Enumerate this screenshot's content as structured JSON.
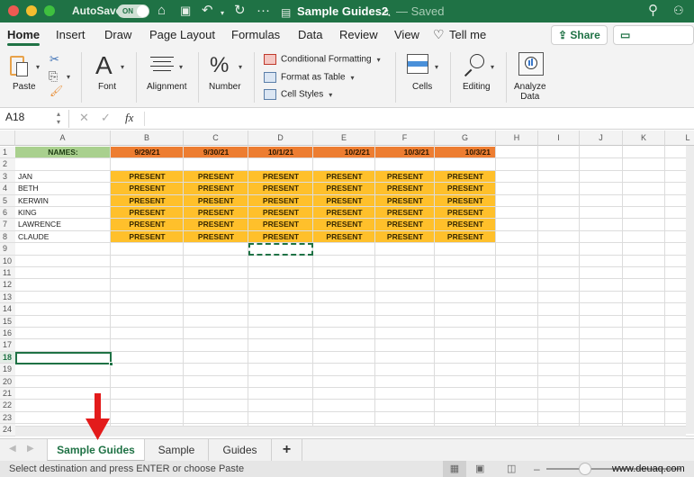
{
  "titlebar": {
    "autosave_label": "AutoSave",
    "autosave_state": "ON",
    "document_title": "Sample Guides2",
    "document_status": "— Saved",
    "icons": [
      "home-icon",
      "save-icon",
      "undo-icon",
      "redo-icon",
      "more-icon",
      "search-icon",
      "share-people-icon"
    ]
  },
  "tabs": [
    {
      "label": "Home",
      "active": true
    },
    {
      "label": "Insert"
    },
    {
      "label": "Draw"
    },
    {
      "label": "Page Layout"
    },
    {
      "label": "Formulas"
    },
    {
      "label": "Data"
    },
    {
      "label": "Review"
    },
    {
      "label": "View"
    }
  ],
  "tell_me": "Tell me",
  "share_label": "Share",
  "comments_label": "Comments",
  "ribbon": {
    "paste": "Paste",
    "font": "Font",
    "alignment": "Alignment",
    "number": "Number",
    "conditional_formatting": "Conditional Formatting",
    "format_as_table": "Format as Table",
    "cell_styles": "Cell Styles",
    "cells": "Cells",
    "editing": "Editing",
    "analyze_data_line1": "Analyze",
    "analyze_data_line2": "Data"
  },
  "formula_bar": {
    "name_box": "A18",
    "fx": "fx",
    "formula": ""
  },
  "columns": [
    "A",
    "B",
    "C",
    "D",
    "E",
    "F",
    "G",
    "H",
    "I",
    "J",
    "K",
    "L"
  ],
  "rows": [
    "1",
    "2",
    "3",
    "4",
    "5",
    "6",
    "7",
    "8",
    "9",
    "10",
    "11",
    "12",
    "13",
    "14",
    "15",
    "16",
    "17",
    "18",
    "19",
    "20",
    "21",
    "22",
    "23",
    "24"
  ],
  "sheet": {
    "header_label": "NAMES:",
    "dates": [
      "9/29/21",
      "9/30/21",
      "10/1/21",
      "10/2/21",
      "10/3/21",
      "10/3/21"
    ],
    "names": [
      "JAN",
      "BETH",
      "KERWIN",
      "KING",
      "LAWRENCE",
      "CLAUDE"
    ],
    "status_value": "PRESENT",
    "selected_cell": "A18",
    "copy_marquee_cell": "D9",
    "colors": {
      "names_header_bg": "#a9d08e",
      "date_header_bg": "#ed7d31",
      "present_bg": "#ffc02b",
      "accent": "#1f7245"
    }
  },
  "sheet_tabs": [
    {
      "label": "Sample Guides",
      "active": true
    },
    {
      "label": "Sample"
    },
    {
      "label": "Guides"
    }
  ],
  "add_sheet": "+",
  "status_bar": {
    "message": "Select destination and press ENTER or choose Paste",
    "watermark": "www.deuaq.com"
  }
}
